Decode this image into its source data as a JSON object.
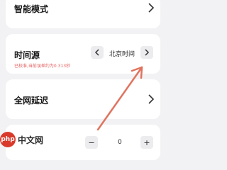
{
  "smart_mode": {
    "label": "智能模式"
  },
  "time_source": {
    "label": "时间源",
    "value": "北京时间",
    "note": "已校准,当前误差约为0.313秒"
  },
  "network_latency": {
    "label": "全网延迟"
  },
  "partial_row": {
    "label": "",
    "value": "0",
    "minus": "−",
    "plus": "+"
  },
  "watermark": {
    "logo": "php",
    "text": "中文网"
  },
  "colors": {
    "arrow": "#e0735e",
    "note": "#e35d5d",
    "card": "#ffffff",
    "background": "#f2f2f4"
  }
}
